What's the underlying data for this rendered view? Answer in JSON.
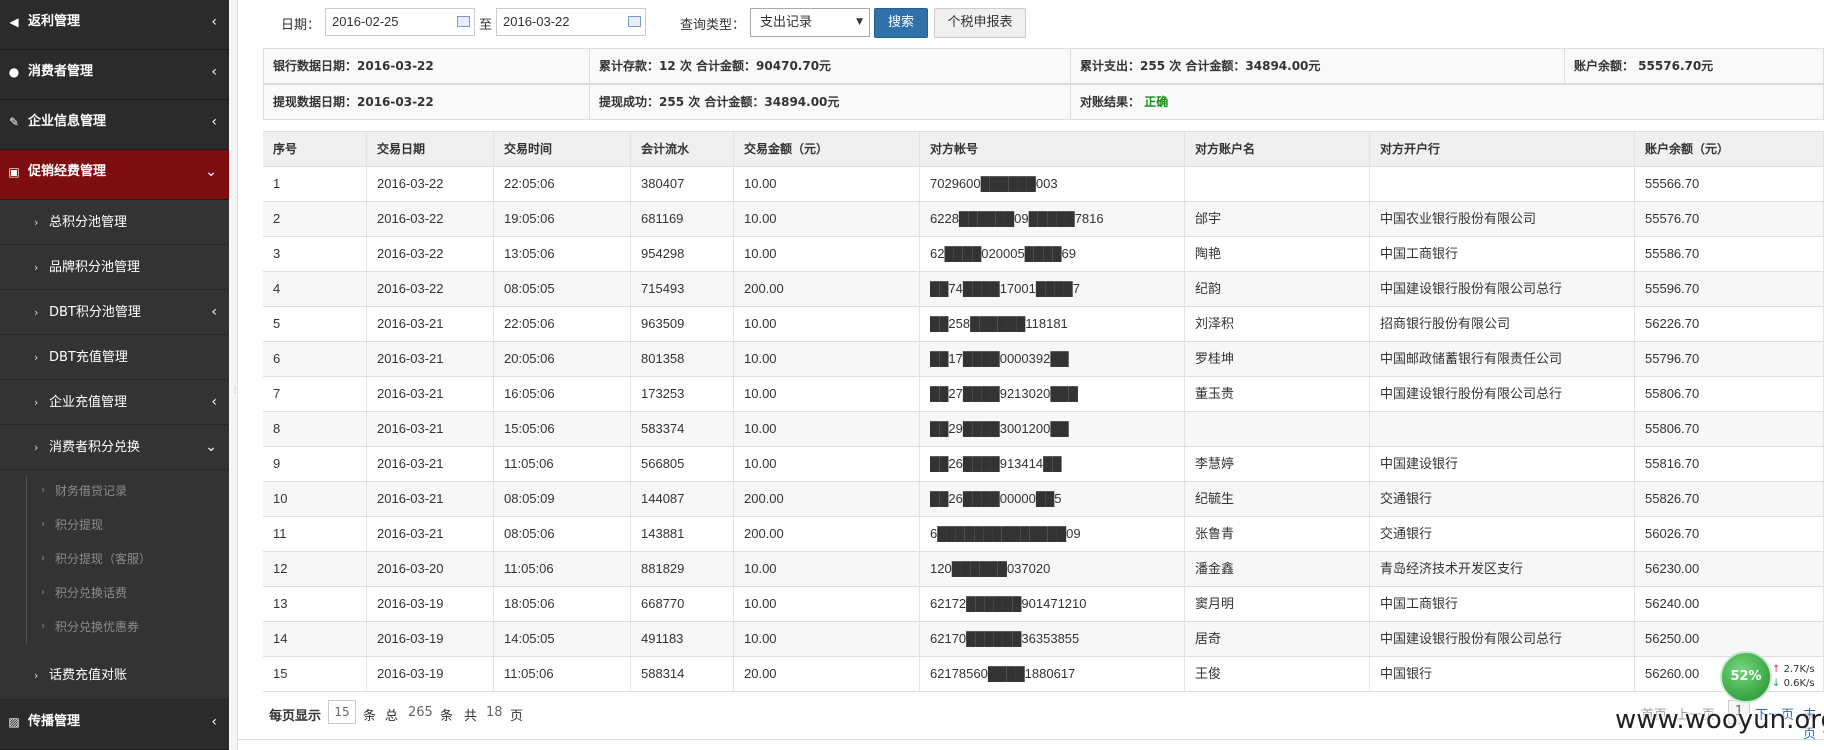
{
  "sidebar": {
    "top_items": [
      {
        "label": "返利管理",
        "icon": "megaphone-icon",
        "glyph": "◀"
      },
      {
        "label": "消费者管理",
        "icon": "user-icon",
        "glyph": "●"
      },
      {
        "label": "企业信息管理",
        "icon": "edit-icon",
        "glyph": "✎"
      },
      {
        "label": "促销经费管理",
        "icon": "money-icon",
        "glyph": "▣"
      }
    ],
    "sub_items": [
      {
        "label": "总积分池管理"
      },
      {
        "label": "品牌积分池管理"
      },
      {
        "label": "DBT积分池管理"
      },
      {
        "label": "DBT充值管理"
      },
      {
        "label": "企业充值管理"
      },
      {
        "label": "消费者积分兑换"
      }
    ],
    "third_items": [
      {
        "label": "财务借贷记录"
      },
      {
        "label": "积分提现"
      },
      {
        "label": "积分提现（客服）"
      },
      {
        "label": "积分兑换话费"
      },
      {
        "label": "积分兑换优惠券"
      }
    ],
    "recharge_item": "话费充值对账",
    "bottom_item": {
      "label": "传播管理",
      "icon": "image-icon",
      "glyph": "▨"
    },
    "chevron_right": "›",
    "arrow_left": "‹",
    "arrow_down": "⌄"
  },
  "filter": {
    "date_label": "日期：",
    "date_from": "2016-02-25",
    "to_label": "至",
    "date_to": "2016-03-22",
    "type_label": "查询类型：",
    "type_value": "支出记录",
    "search_button": "搜索",
    "report_button": "个税申报表"
  },
  "summary": {
    "row1": [
      "银行数据日期：2016-03-22",
      "累计存款：12 次 合计金额：90470.70元",
      "累计支出：255 次 合计金额：34894.00元",
      "账户余额： 55576.70元"
    ],
    "row2": [
      "提现数据日期：2016-03-22",
      "提现成功：255 次 合计金额：34894.00元",
      "对账结果："
    ],
    "result": "正确",
    "result_color": "#198c19"
  },
  "table": {
    "headers": [
      "序号",
      "交易日期",
      "交易时间",
      "会计流水",
      "交易金额（元）",
      "对方帐号",
      "对方账户名",
      "对方开户行",
      "账户余额（元）"
    ],
    "rows": [
      [
        "1",
        "2016-03-22",
        "22:05:06",
        "380407",
        "10.00",
        "7029600██████003",
        "",
        "",
        "55566.70"
      ],
      [
        "2",
        "2016-03-22",
        "19:05:06",
        "681169",
        "10.00",
        "6228██████09█████7816",
        "邰宇",
        "中国农业银行股份有限公司",
        "55576.70"
      ],
      [
        "3",
        "2016-03-22",
        "13:05:06",
        "954298",
        "10.00",
        "62████020005████69",
        "陶艳",
        "中国工商银行",
        "55586.70"
      ],
      [
        "4",
        "2016-03-22",
        "08:05:05",
        "715493",
        "200.00",
        "██74████17001████7",
        "纪韵",
        "中国建设银行股份有限公司总行",
        "55596.70"
      ],
      [
        "5",
        "2016-03-21",
        "22:05:06",
        "963509",
        "10.00",
        "██258██████118181",
        "刘泽积",
        "招商银行股份有限公司",
        "56226.70"
      ],
      [
        "6",
        "2016-03-21",
        "20:05:06",
        "801358",
        "10.00",
        "██17████0000392██",
        "罗桂坤",
        "中国邮政储蓄银行有限责任公司",
        "55796.70"
      ],
      [
        "7",
        "2016-03-21",
        "16:05:06",
        "173253",
        "10.00",
        "██27████9213020███",
        "董玉贵",
        "中国建设银行股份有限公司总行",
        "55806.70"
      ],
      [
        "8",
        "2016-03-21",
        "15:05:06",
        "583374",
        "10.00",
        "██29████3001200██",
        "",
        "",
        "55806.70"
      ],
      [
        "9",
        "2016-03-21",
        "11:05:06",
        "566805",
        "10.00",
        "██26████913414██",
        "李慧婷",
        "中国建设银行",
        "55816.70"
      ],
      [
        "10",
        "2016-03-21",
        "08:05:09",
        "144087",
        "200.00",
        "██26████00000██5",
        "纪毓生",
        "交通银行",
        "55826.70"
      ],
      [
        "11",
        "2016-03-21",
        "08:05:06",
        "143881",
        "200.00",
        "6██████████████09",
        "张鲁青",
        "交通银行",
        "56026.70"
      ],
      [
        "12",
        "2016-03-20",
        "11:05:06",
        "881829",
        "10.00",
        "120██████037020",
        "潘金鑫",
        "青岛经济技术开发区支行",
        "56230.00"
      ],
      [
        "13",
        "2016-03-19",
        "18:05:06",
        "668770",
        "10.00",
        "62172██████901471210",
        "窦月明",
        "中国工商银行",
        "56240.00"
      ],
      [
        "14",
        "2016-03-19",
        "14:05:05",
        "491183",
        "10.00",
        "62170██████36353855",
        "居奇",
        "中国建设银行股份有限公司总行",
        "56250.00"
      ],
      [
        "15",
        "2016-03-19",
        "11:05:06",
        "588314",
        "20.00",
        "62178560████1880617",
        "王俊",
        "中国银行",
        "56260.00"
      ]
    ]
  },
  "pagination": {
    "per_page_label": "每页显示",
    "per_page": "15",
    "tiao": "条",
    "total_label": "总",
    "total": "265",
    "tiao2": "条",
    "gong": "共",
    "pages": "18",
    "ye": "页",
    "first": "首页",
    "prev": "上一页",
    "current": "1",
    "next": "下一页",
    "last": "末页"
  },
  "widget": {
    "percent": "52%",
    "up": "2.7K/s",
    "down": "0.6K/s",
    "up_arrow": "↑",
    "down_arrow": "↓"
  },
  "watermark": "www.wooyun.org"
}
